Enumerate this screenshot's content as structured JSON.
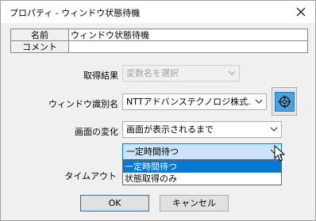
{
  "window": {
    "title": "プロパティ - ウィンドウ状態待機"
  },
  "info_table": [
    {
      "key": "名前",
      "value": "ウィンドウ状態待機"
    },
    {
      "key": "コメント",
      "value": ""
    }
  ],
  "form": {
    "acquire_result": {
      "label": "取得結果",
      "value": "変数名を選択",
      "enabled": false
    },
    "window_id": {
      "label": "ウィンドウ識別名",
      "value": "NTTアドバンステクノロジ株式..."
    },
    "screen_change": {
      "label": "画面の変化",
      "value": "画面が表示されるまで"
    },
    "wait_mode": {
      "value": "一定時間待つ",
      "options": [
        "一定時間待つ",
        "状態取得のみ"
      ],
      "selected_index": 0
    },
    "timeout": {
      "label": "タイムアウト"
    }
  },
  "buttons": {
    "ok": "OK",
    "cancel": "キャンセル"
  },
  "icons": {
    "close": "close-icon",
    "target": "window-target-icon",
    "dropdown": "chevron-down-icon"
  },
  "colors": {
    "accent": "#0078d7",
    "selection": "#0078d7",
    "target_icon": "#4aa3df"
  }
}
